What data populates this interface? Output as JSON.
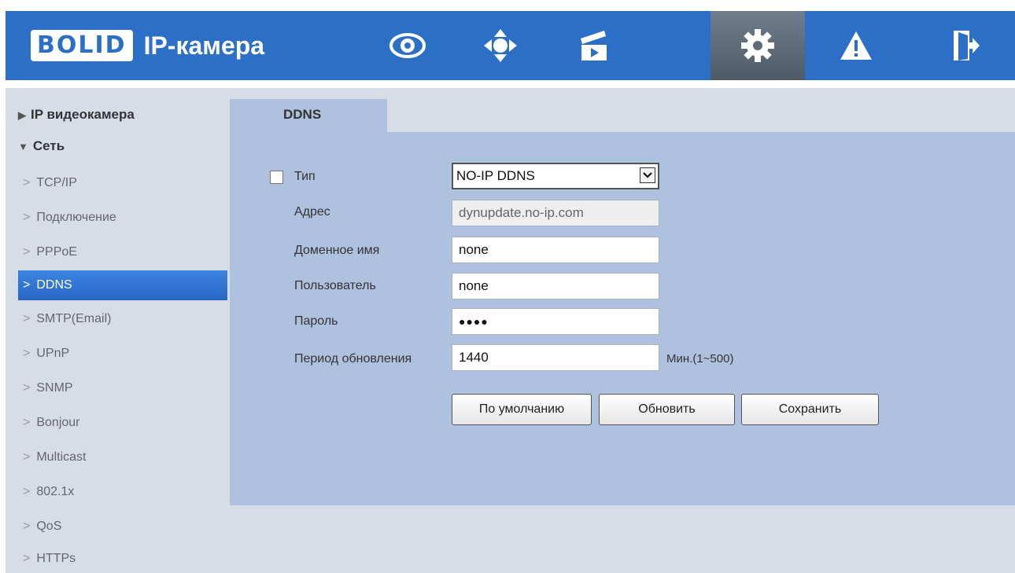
{
  "header": {
    "logo_brand": "BOLID",
    "logo_title": "IP-камера",
    "nav_icons": [
      "eye-icon",
      "ptz-icon",
      "playback-icon",
      "settings-gear-icon",
      "alarm-warning-icon",
      "logout-icon"
    ],
    "accent_color": "#2c6fc7"
  },
  "sidebar": {
    "group_camera": "IP видеокамера",
    "group_network": "Сеть",
    "items": [
      "TCP/IP",
      "Подключение",
      "PPPoE",
      "DDNS",
      "SMTP(Email)",
      "UPnP",
      "SNMP",
      "Bonjour",
      "Multicast",
      "802.1x",
      "QoS",
      "HTTPs"
    ],
    "active_item": "DDNS"
  },
  "tab": {
    "label": "DDNS"
  },
  "form": {
    "type_label": "Тип",
    "type_checked": false,
    "type_value": "NO-IP DDNS",
    "address_label": "Адрес",
    "address_value": "dynupdate.no-ip.com",
    "domain_label": "Доменное имя",
    "domain_value": "none",
    "user_label": "Пользователь",
    "user_value": "none",
    "password_label": "Пароль",
    "password_value": "●●●●",
    "period_label": "Период обновления",
    "period_value": "1440",
    "period_unit": "Мин.(1~500)"
  },
  "buttons": {
    "default_label": "По умолчанию",
    "refresh_label": "Обновить",
    "save_label": "Сохранить"
  }
}
